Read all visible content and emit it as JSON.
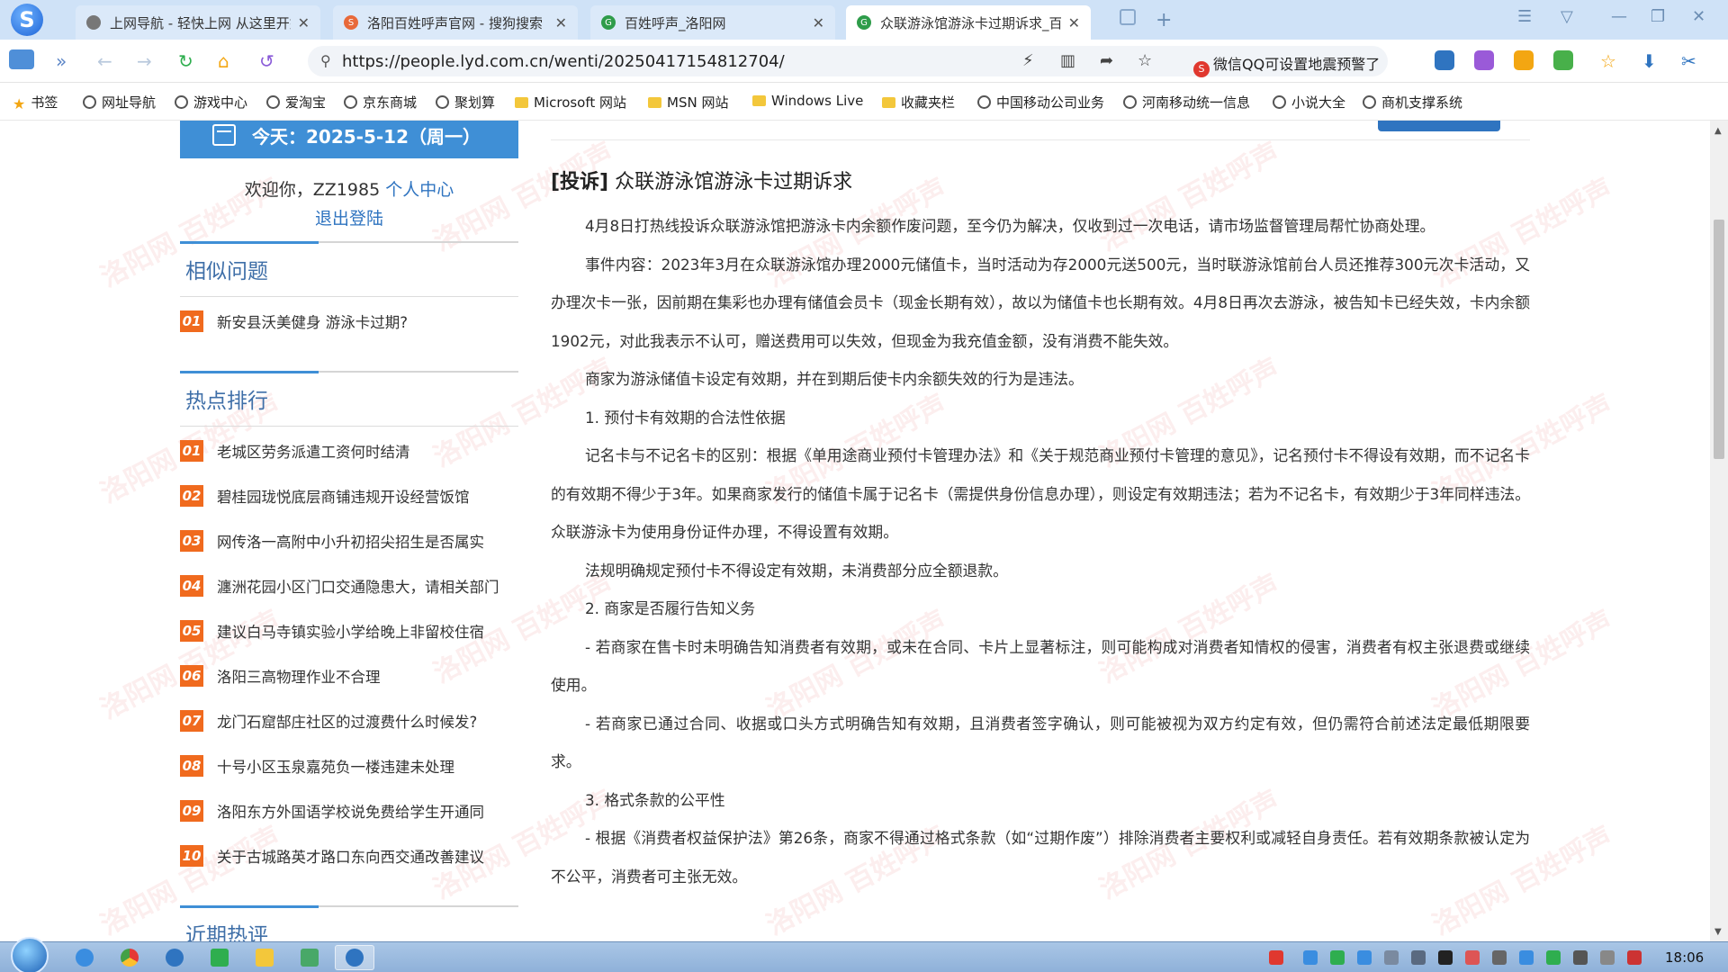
{
  "browser": {
    "tabs": [
      {
        "title": "上网导航 - 轻快上网 从这里开始",
        "favicon_color": "#777777",
        "active": false
      },
      {
        "title": "洛阳百姓呼声官网 - 搜狗搜索",
        "favicon_color": "#e8693a",
        "active": false
      },
      {
        "title": "百姓呼声_洛阳网",
        "favicon_color": "#2e9c4a",
        "active": false
      },
      {
        "title": "众联游泳馆游泳卡过期诉求_百姓呼声_洛阳网",
        "favicon_color": "#2e9c4a",
        "active": true
      }
    ],
    "url": "https://people.lyd.com.cn/wenti/20250417154812704/",
    "notice": "微信QQ可设置地震预警了"
  },
  "bookmarks": [
    {
      "label": "书签",
      "icon": "star-icon"
    },
    {
      "label": "网址导航",
      "icon": "globe-icon"
    },
    {
      "label": "游戏中心",
      "icon": "globe-icon"
    },
    {
      "label": "爱淘宝",
      "icon": "globe-icon"
    },
    {
      "label": "京东商城",
      "icon": "globe-icon"
    },
    {
      "label": "聚划算",
      "icon": "globe-icon"
    },
    {
      "label": "Microsoft 网站",
      "icon": "folder-icon"
    },
    {
      "label": "MSN 网站",
      "icon": "folder-icon"
    },
    {
      "label": "Windows Live",
      "icon": "folder-icon"
    },
    {
      "label": "收藏夹栏",
      "icon": "folder-icon"
    },
    {
      "label": "中国移动公司业务",
      "icon": "globe-icon"
    },
    {
      "label": "河南移动统一信息",
      "icon": "globe-icon"
    },
    {
      "label": "小说大全",
      "icon": "globe-icon"
    },
    {
      "label": "商机支撑系统",
      "icon": "globe-icon"
    }
  ],
  "sidebar": {
    "date": "今天：2025-5-12（周一）",
    "welcome_prefix": "欢迎你，ZZ1985",
    "personal_center": "个人中心",
    "logout": "退出登陆",
    "similar_title": "相似问题",
    "similar": [
      {
        "num": "01",
        "text": "新安县沃美健身 游泳卡过期?"
      }
    ],
    "hot_title": "热点排行",
    "hot": [
      {
        "num": "01",
        "text": "老城区劳务派遣工资何时结清"
      },
      {
        "num": "02",
        "text": "碧桂园珑悦底层商铺违规开设经营饭馆"
      },
      {
        "num": "03",
        "text": "网传洛一高附中小升初招尖招生是否属实"
      },
      {
        "num": "04",
        "text": "瀍洲花园小区门口交通隐患大，请相关部门"
      },
      {
        "num": "05",
        "text": "建议白马寺镇实验小学给晚上非留校住宿"
      },
      {
        "num": "06",
        "text": "洛阳三高物理作业不合理"
      },
      {
        "num": "07",
        "text": "龙门石窟郜庄社区的过渡费什么时候发?"
      },
      {
        "num": "08",
        "text": "十号小区玉泉嘉苑负一楼违建未处理"
      },
      {
        "num": "09",
        "text": "洛阳东方外国语学校说免费给学生开通同"
      },
      {
        "num": "10",
        "text": "关于古城路英才路口东向西交通改善建议"
      }
    ],
    "recent_title": "近期热评"
  },
  "article": {
    "tag": "[投诉]",
    "title": "众联游泳馆游泳卡过期诉求",
    "paragraphs": [
      "4月8日打热线投诉众联游泳馆把游泳卡内余额作废问题，至今仍为解决，仅收到过一次电话，请市场监督管理局帮忙协商处理。",
      "事件内容：2023年3月在众联游泳馆办理2000元储值卡，当时活动为存2000元送500元，当时联游泳馆前台人员还推荐300元次卡活动，又办理次卡一张，因前期在集彩也办理有储值会员卡（现金长期有效），故以为储值卡也长期有效。4月8日再次去游泳，被告知卡已经失效，卡内余额1902元，对此我表示不认可，赠送费用可以失效，但现金为我充值金额，没有消费不能失效。",
      "商家为游泳储值卡设定有效期，并在到期后使卡内余额失效的行为是违法。",
      "1. 预付卡有效期的合法性依据",
      "记名卡与不记名卡的区别：根据《单用途商业预付卡管理办法》和《关于规范商业预付卡管理的意见》，记名预付卡不得设有效期，而不记名卡的有效期不得少于3年。如果商家发行的储值卡属于记名卡（需提供身份信息办理），则设定有效期违法；若为不记名卡，有效期少于3年同样违法。众联游泳卡为使用身份证件办理，不得设置有效期。",
      "法规明确规定预付卡不得设定有效期，未消费部分应全额退款。",
      "2. 商家是否履行告知义务",
      "- 若商家在售卡时未明确告知消费者有效期，或未在合同、卡片上显著标注，则可能构成对消费者知情权的侵害，消费者有权主张退费或继续使用。",
      "- 若商家已通过合同、收据或口头方式明确告知有效期，且消费者签字确认，则可能被视为双方约定有效，但仍需符合前述法定最低期限要求。",
      "3. 格式条款的公平性",
      "- 根据《消费者权益保护法》第26条，商家不得通过格式条款（如“过期作废”）排除消费者主要权利或减轻自身责任。若有效期条款被认定为不公平，消费者可主张无效。"
    ]
  },
  "taskbar": {
    "clock": "18:06"
  }
}
